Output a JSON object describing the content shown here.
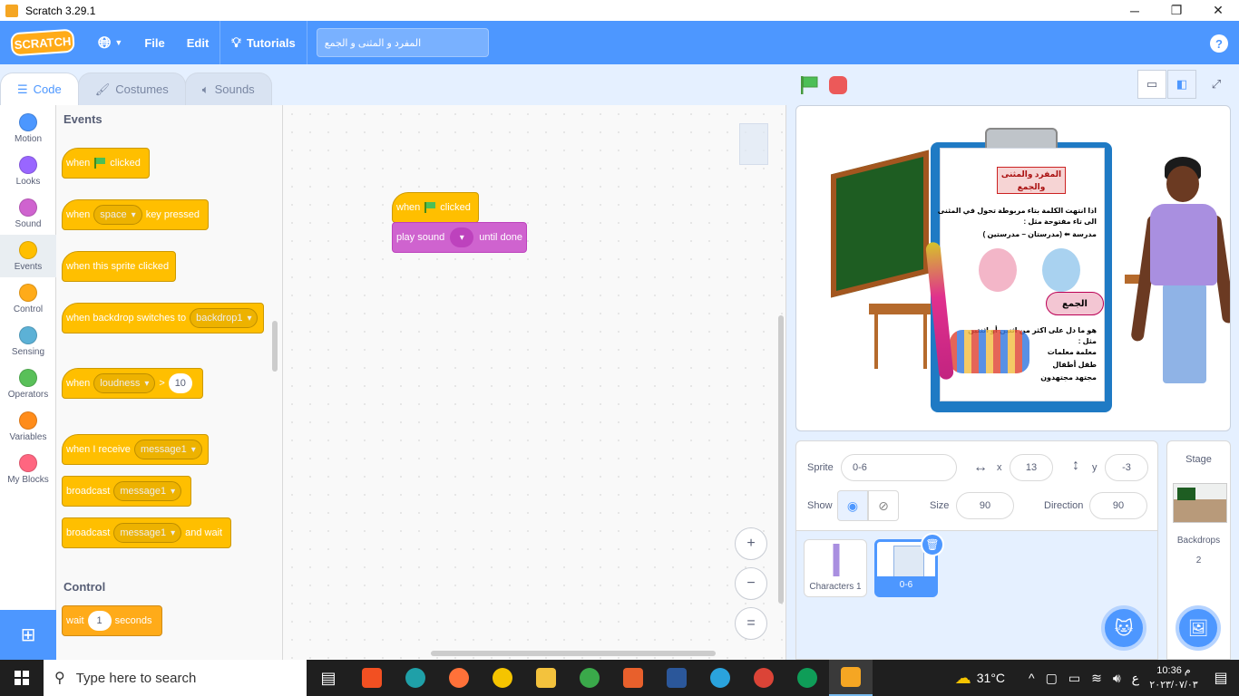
{
  "window": {
    "title": "Scratch 3.29.1",
    "controls": [
      "─",
      "❐",
      "✕"
    ]
  },
  "menubar": {
    "logo": "SCRATCH",
    "file": "File",
    "edit": "Edit",
    "tutorials": "Tutorials",
    "project_title": "المفرد و المثنى و الجمع",
    "help": "?"
  },
  "tabs": [
    {
      "label": "Code",
      "icon": "code-icon"
    },
    {
      "label": "Costumes",
      "icon": "brush-icon"
    },
    {
      "label": "Sounds",
      "icon": "speaker-icon"
    }
  ],
  "categories": [
    {
      "label": "Motion",
      "color": "#4c97ff"
    },
    {
      "label": "Looks",
      "color": "#9966ff"
    },
    {
      "label": "Sound",
      "color": "#cf63cf"
    },
    {
      "label": "Events",
      "color": "#ffbf00"
    },
    {
      "label": "Control",
      "color": "#ffab19"
    },
    {
      "label": "Sensing",
      "color": "#5cb1d6"
    },
    {
      "label": "Operators",
      "color": "#59c059"
    },
    {
      "label": "Variables",
      "color": "#ff8c1a"
    },
    {
      "label": "My Blocks",
      "color": "#ff6680"
    }
  ],
  "palette": {
    "events_title": "Events",
    "control_title": "Control",
    "blocks": {
      "flag_when": "when",
      "flag_clicked": "clicked",
      "key_when": "when",
      "key_value": "space",
      "key_pressed": "key pressed",
      "sprite_clicked": "when this sprite clicked",
      "backdrop_switch": "when backdrop switches to",
      "backdrop_value": "backdrop1",
      "loud_when": "when",
      "loud_value": "loudness",
      "loud_op": ">",
      "loud_num": "10",
      "receive": "when I receive",
      "receive_value": "message1",
      "broadcast": "broadcast",
      "broadcast_value": "message1",
      "broadcast_wait": "broadcast",
      "broadcast_wait_value": "message1",
      "and_wait": "and wait",
      "wait": "wait",
      "wait_num": "1",
      "seconds": "seconds"
    }
  },
  "script": {
    "hat_when": "when",
    "hat_clicked": "clicked",
    "sound_play": "play sound",
    "sound_until": "until done",
    "zoom_in": "+",
    "zoom_out": "−",
    "zoom_reset": "="
  },
  "stage_content": {
    "heading": "المفرد والمثنى والجمع",
    "line1": "اذا انتهت الكلمة بتاء مربوطة تحول في المثنى",
    "line2": "الى تاء مفتوحة مثل :",
    "line3": "مدرسة ⬅ (مدرستان – مدرستين )",
    "plural_title": "الجمع",
    "plural_def": "هو ما دل على اكثر من اثنين أو اثنتين",
    "example": "مثل :",
    "ex1": "معلمة   معلمات",
    "ex2": "طفل   أطفال",
    "ex3": "مجتهد   مجتهدون"
  },
  "sprite_info": {
    "sprite_label": "Sprite",
    "sprite_name": "0-6",
    "x_label": "x",
    "x_value": "13",
    "y_label": "y",
    "y_value": "-3",
    "show_label": "Show",
    "size_label": "Size",
    "size_value": "90",
    "direction_label": "Direction",
    "direction_value": "90"
  },
  "sprites": [
    {
      "name": "Characters 1",
      "selected": false
    },
    {
      "name": "0-6",
      "selected": true
    }
  ],
  "stage_pane": {
    "title": "Stage",
    "backdrops_label": "Backdrops",
    "backdrops_count": "2"
  },
  "taskbar": {
    "search_placeholder": "Type here to search",
    "weather": "31°C",
    "lang": "ع",
    "time": "10:36 م",
    "date": "٢٠٢٣/٠٧/٠٣"
  }
}
